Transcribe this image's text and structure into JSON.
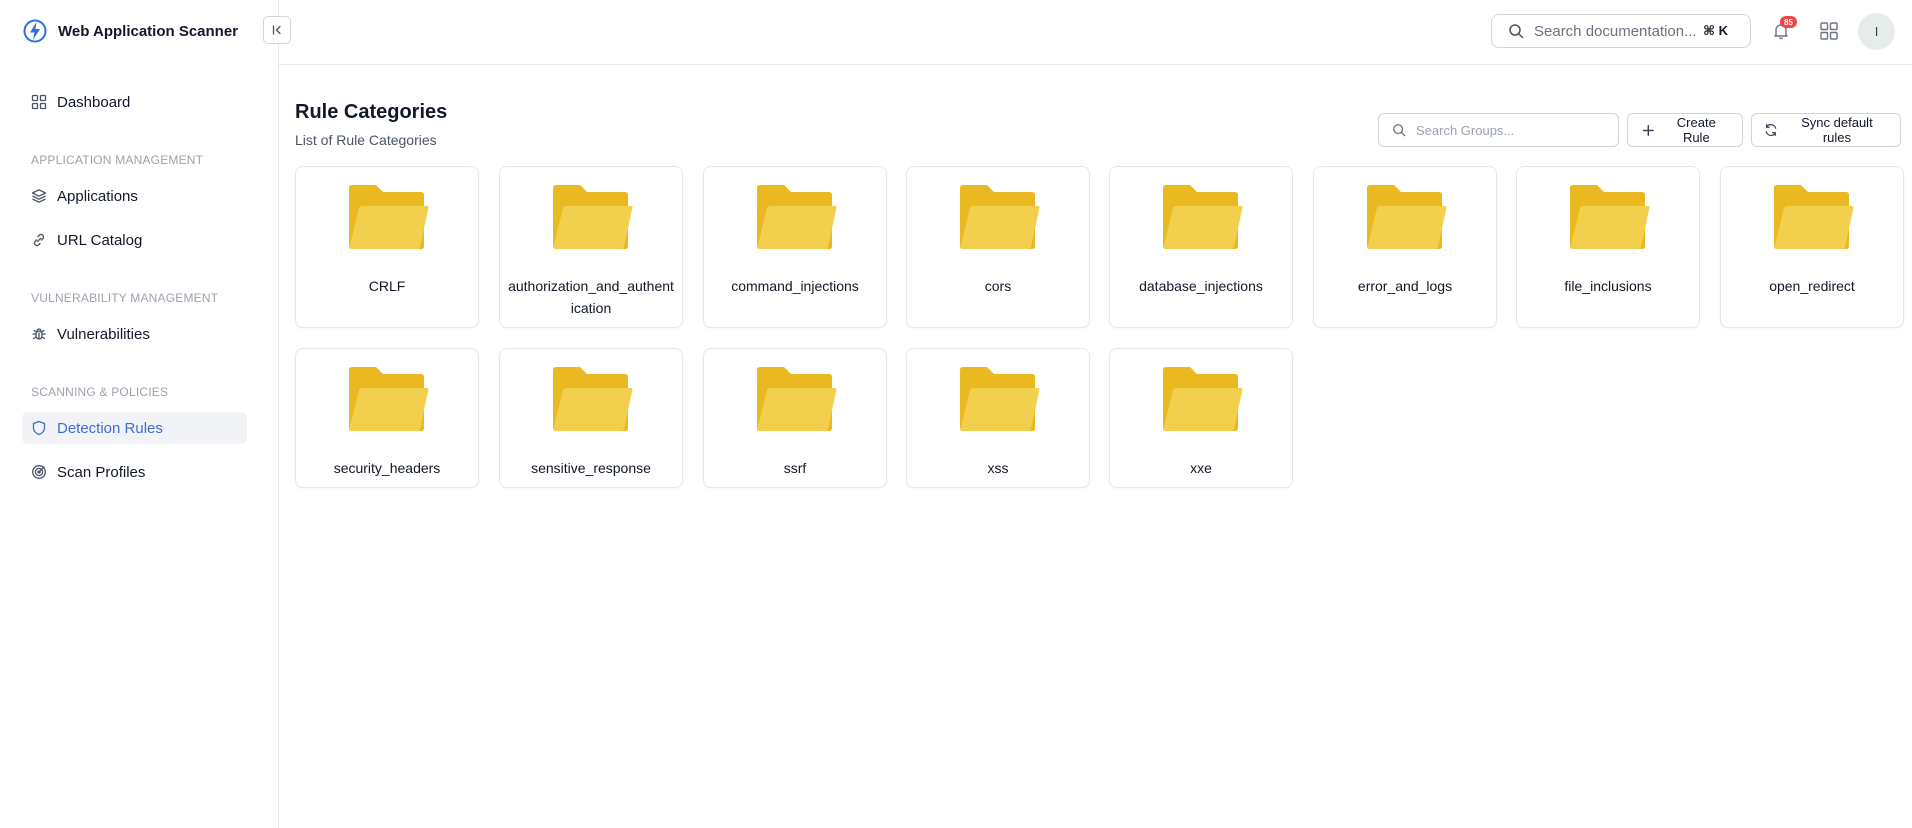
{
  "app": {
    "title": "Web Application Scanner"
  },
  "header": {
    "search_placeholder": "Search documentation...",
    "search_shortcut": "⌘ K",
    "notification_count": "85",
    "avatar_initial": "I"
  },
  "sidebar": {
    "dashboard": "Dashboard",
    "sections": {
      "app_mgmt": "APPLICATION MANAGEMENT",
      "vuln_mgmt": "VULNERABILITY MANAGEMENT",
      "scan_policies": "SCANNING & POLICIES"
    },
    "items": {
      "applications": "Applications",
      "url_catalog": "URL Catalog",
      "vulnerabilities": "Vulnerabilities",
      "detection_rules": "Detection Rules",
      "scan_profiles": "Scan Profiles"
    },
    "active": "Detection Rules"
  },
  "main": {
    "title": "Rule Categories",
    "subtitle": "List of Rule Categories",
    "search_placeholder": "Search Groups...",
    "create_label": "Create Rule",
    "sync_label": "Sync default rules",
    "categories": [
      "CRLF",
      "authorization_and_authentication",
      "command_injections",
      "cors",
      "database_injections",
      "error_and_logs",
      "file_inclusions",
      "open_redirect",
      "security_headers",
      "sensitive_response",
      "ssrf",
      "xss",
      "xxe"
    ]
  },
  "colors": {
    "accent": "#3b6fd0",
    "folder_back": "#eab820",
    "folder_front": "#f2d04e",
    "badge": "#ef4444"
  }
}
